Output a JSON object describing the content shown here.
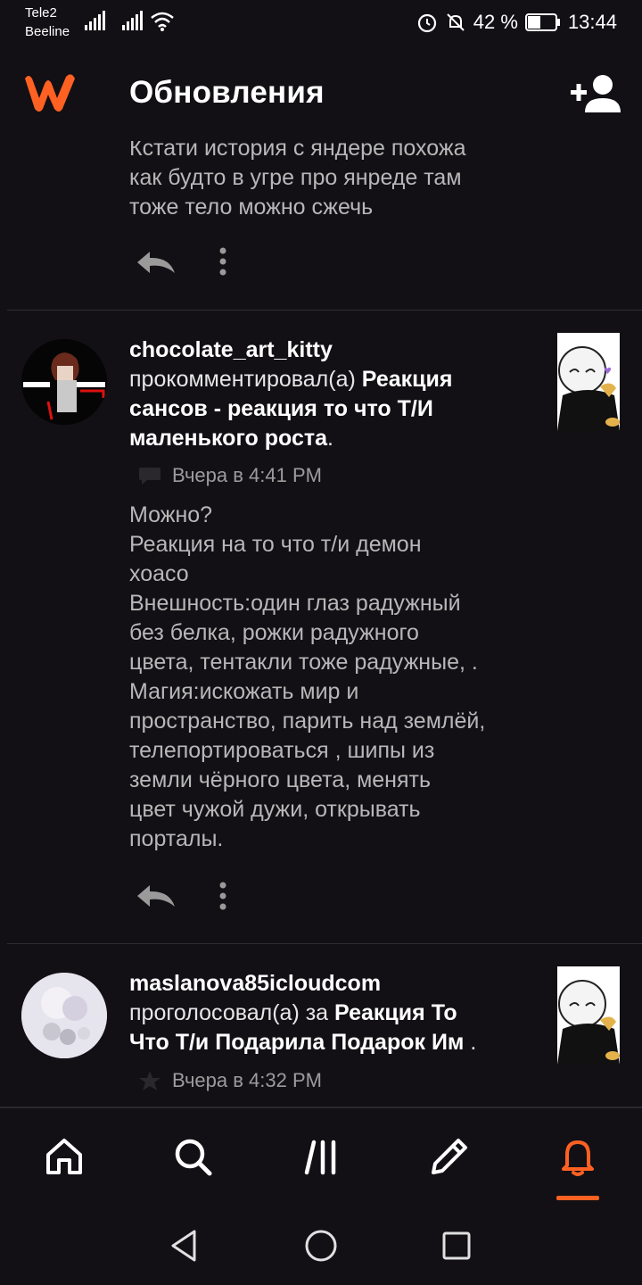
{
  "status_bar": {
    "carrier1": "Tele2",
    "carrier2": "Beeline",
    "battery": "42 %",
    "time": "13:44"
  },
  "header": {
    "title": "Обновления",
    "icons": {
      "logo": "wattpad-logo",
      "add": "add-user-icon"
    }
  },
  "feed": {
    "partial_item": {
      "text_lines": [
        "Кстати история с яндере похожа",
        "как будто в угре про янреде там",
        "тоже тело можно сжечь"
      ]
    },
    "item1": {
      "username": "chocolate_art_kitty",
      "action_line1_prefix": "прокомментировал(а)",
      "action_line1_story": "Реакция",
      "action_line2": "сансов - реакция то что Т/И",
      "action_line3": "маленького роста",
      "action_line3_suffix": ".",
      "time": "Вчера в 4:41 PM",
      "comment_lines": [
        "Можно?",
        "Реакция на то что т/и демон",
        "хоасо",
        "Внешность:один глаз радужный",
        "без белка, рожки радужного",
        "цвета, тентакли тоже радужные, .",
        "Магия:искожать мир и",
        "пространство, парить над землёй,",
        "телепортироваться , шипы из",
        "земли чёрного цвета, менять",
        "цвет чужой дужи, открывать",
        "порталы."
      ]
    },
    "item2": {
      "username": "maslanova85icloudcom",
      "action_line1_prefix": "проголосовал(а) за",
      "action_line1_story": "Реакция То",
      "action_line2": "Что Т/и Подарила Подарок Им",
      "action_line2_suffix": ".",
      "time": "Вчера в 4:32 PM"
    }
  },
  "colors": {
    "accent": "#ff6122",
    "background": "#121015",
    "muted": "#b7b7b7"
  },
  "bottom_nav": [
    "home-icon",
    "search-icon",
    "library-icon",
    "write-icon",
    "notifications-icon"
  ]
}
